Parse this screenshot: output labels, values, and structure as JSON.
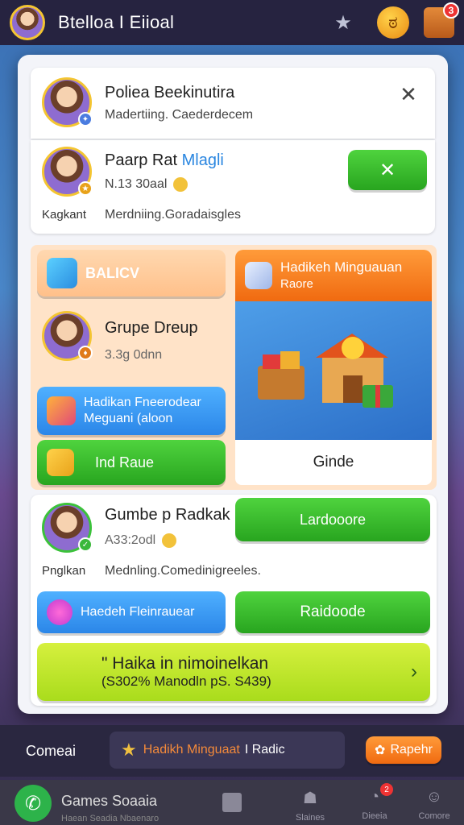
{
  "app_title": "Btelloa I Eiioal",
  "top_badge_count": "3",
  "header_card": {
    "name": "Poliea Beekinutira",
    "subtitle": "Madertiing. Caederdecem"
  },
  "player1": {
    "name": "Paarp Rat",
    "name_accent": "Mlagli",
    "score": "N.13 30aal",
    "label": "Kagkant",
    "desc": "Merdniing.Goradaisgles"
  },
  "orange_header": {
    "label": "Hadikeh Minguauan",
    "sub": "Raore"
  },
  "badge_button": {
    "label": "BALICV"
  },
  "player2": {
    "name": "Grupe Dreup",
    "score": "3.3g 0dnn"
  },
  "blue_button": {
    "line1": "Hadikan Fneerodear",
    "line2": "Meguani (aloon"
  },
  "green_small": {
    "label": "Ind Raue"
  },
  "illustration_caption": "Ginde",
  "player3": {
    "name": "Gumbe p Radkak",
    "score": "A33:2odl",
    "label": "Pnglkan",
    "desc": "Mednling.Comedinigreeles."
  },
  "green_wide": {
    "label": "Lardooore"
  },
  "heart_button": {
    "label": "Haedeh Fleinrauear"
  },
  "green_wide2": {
    "label": "Raidoode"
  },
  "promo": {
    "title": "\" Haika in nimoinelkan",
    "sub": "(S302% Manodln pS. S439)",
    "arrow": "›"
  },
  "mid": {
    "left": "Comeai",
    "center": "Hadikh Minguaat",
    "center2": "I Radic",
    "right": "Rapehr"
  },
  "bottom": {
    "app": "Games Soaaia",
    "app_sub": "Haean Seadia Nbaenaro",
    "tabs": [
      "Slaines",
      "Dieeia",
      "Comore"
    ],
    "tab_badge": "2"
  },
  "colors": {
    "accent_green": "#34b82a",
    "accent_blue": "#3a98f4",
    "accent_orange": "#f57a1c"
  }
}
